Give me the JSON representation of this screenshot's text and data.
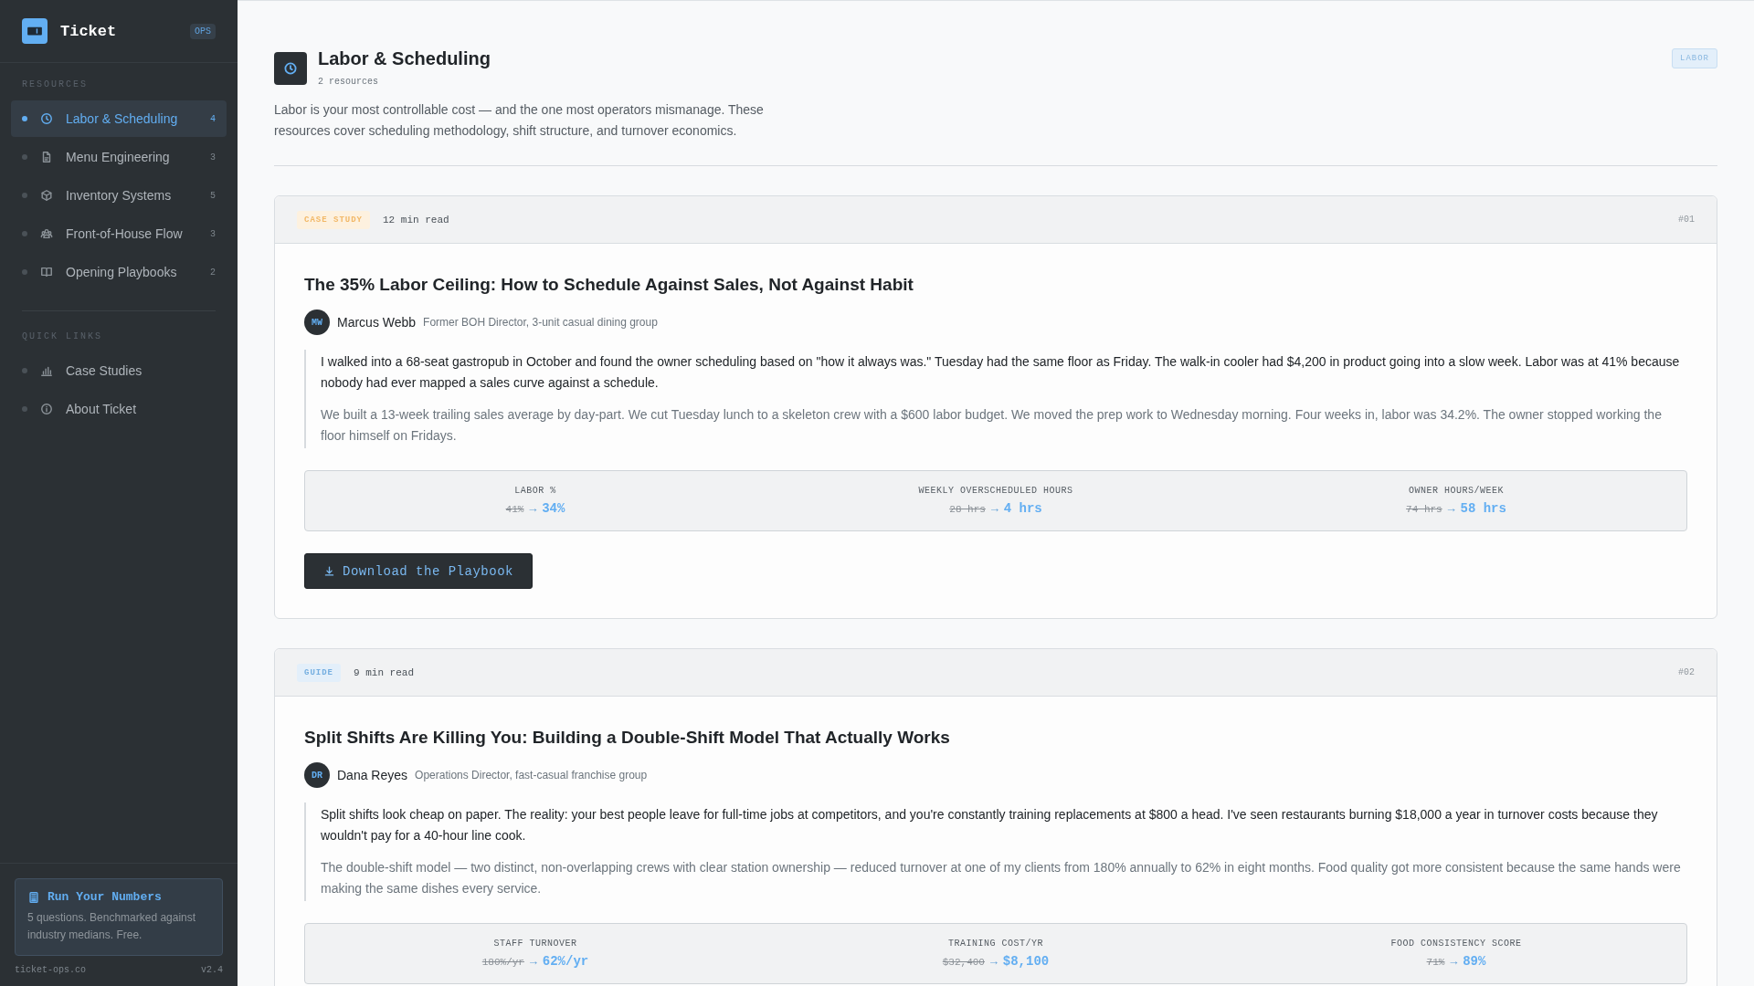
{
  "sidebar": {
    "brand": {
      "name": "Ticket",
      "badge": "OPS"
    },
    "sections": [
      {
        "heading": "RESOURCES",
        "items": [
          {
            "label": "Labor & Scheduling",
            "count": "4",
            "selected": true
          },
          {
            "label": "Menu Engineering",
            "count": "3",
            "selected": false
          },
          {
            "label": "Inventory Systems",
            "count": "5",
            "selected": false
          },
          {
            "label": "Front-of-House Flow",
            "count": "3",
            "selected": false
          },
          {
            "label": "Opening Playbooks",
            "count": "2",
            "selected": false
          }
        ]
      },
      {
        "heading": "QUICK LINKS",
        "items": [
          {
            "label": "Case Studies",
            "selected": false
          },
          {
            "label": "About Ticket",
            "selected": false
          }
        ]
      }
    ],
    "promo": {
      "title": "Run Your Numbers",
      "text": "5 questions. Benchmarked against industry medians. Free."
    },
    "footer": {
      "domain": "ticket-ops.co",
      "version": "v2.4"
    }
  },
  "page": {
    "title": "Labor & Scheduling",
    "subtitle": "2 resources",
    "tag": "LABOR",
    "description": "Labor is your most controllable cost — and the one most operators mismanage. These resources cover scheduling methodology, shift structure, and turnover economics."
  },
  "articles": [
    {
      "kind": "case-study",
      "type_label": "CASE STUDY",
      "read_time": "12 min read",
      "number": "#01",
      "title": "The 35% Labor Ceiling: How to Schedule Against Sales, Not Against Habit",
      "author": {
        "initials": "MW",
        "name": "Marcus Webb",
        "role": "Former BOH Director, 3-unit casual dining group"
      },
      "paragraphs": [
        "I walked into a 68-seat gastropub in October and found the owner scheduling based on \"how it always was.\" Tuesday had the same floor as Friday. The walk-in cooler had $4,200 in product going into a slow week. Labor was at 41% because nobody had ever mapped a sales curve against a schedule.",
        "We built a 13-week trailing sales average by day-part. We cut Tuesday lunch to a skeleton crew with a $600 labor budget. We moved the prep work to Wednesday morning. Four weeks in, labor was 34.2%. The owner stopped working the floor himself on Fridays."
      ],
      "stats": [
        {
          "label": "LABOR %",
          "before": "41%",
          "arrow": "→",
          "after": "34%"
        },
        {
          "label": "WEEKLY OVERSCHEDULED HOURS",
          "before": "28 hrs",
          "arrow": "→",
          "after": "4 hrs"
        },
        {
          "label": "OWNER HOURS/WEEK",
          "before": "74 hrs",
          "arrow": "→",
          "after": "58 hrs"
        }
      ],
      "button": "Download the Playbook"
    },
    {
      "kind": "guide",
      "type_label": "GUIDE",
      "read_time": "9 min read",
      "number": "#02",
      "title": "Split Shifts Are Killing You: Building a Double-Shift Model That Actually Works",
      "author": {
        "initials": "DR",
        "name": "Dana Reyes",
        "role": "Operations Director, fast-casual franchise group"
      },
      "paragraphs": [
        "Split shifts look cheap on paper. The reality: your best people leave for full-time jobs at competitors, and you're constantly training replacements at $800 a head. I've seen restaurants burning $18,000 a year in turnover costs because they wouldn't pay for a 40-hour line cook.",
        "The double-shift model — two distinct, non-overlapping crews with clear station ownership — reduced turnover at one of my clients from 180% annually to 62% in eight months. Food quality got more consistent because the same hands were making the same dishes every service."
      ],
      "stats": [
        {
          "label": "STAFF TURNOVER",
          "before": "180%/yr",
          "arrow": "→",
          "after": "62%/yr"
        },
        {
          "label": "TRAINING COST/YR",
          "before": "$32,400",
          "arrow": "→",
          "after": "$8,100"
        },
        {
          "label": "FOOD CONSISTENCY SCORE",
          "before": "71%",
          "arrow": "→",
          "after": "89%"
        }
      ]
    }
  ]
}
